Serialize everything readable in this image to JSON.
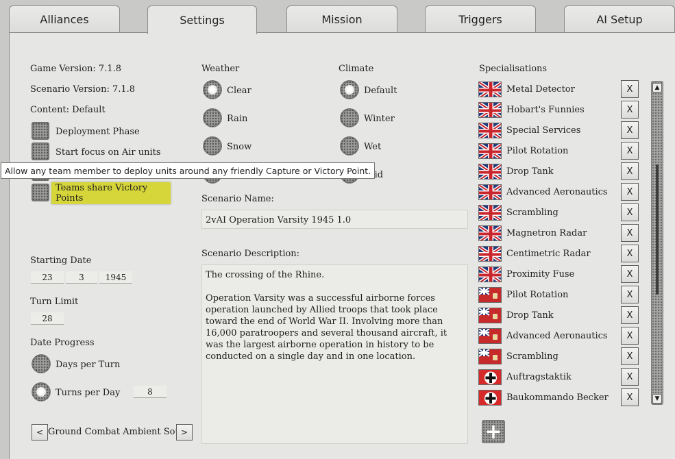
{
  "tabs": [
    {
      "label": "Alliances"
    },
    {
      "label": "Settings"
    },
    {
      "label": "Mission"
    },
    {
      "label": "Triggers"
    },
    {
      "label": "AI Setup"
    }
  ],
  "left": {
    "game_version": "Game Version: 7.1.8",
    "scenario_version": "Scenario Version: 7.1.8",
    "content": "Content: Default",
    "deployment_phase": "Deployment Phase",
    "start_focus": "Start focus on Air units",
    "teams_share_vp": "Teams share Victory Points",
    "starting_date_label": "Starting Date",
    "date_day": "23",
    "date_month": "3",
    "date_year": "1945",
    "turn_limit_label": "Turn Limit",
    "turn_limit": "28",
    "date_progress_label": "Date Progress",
    "days_per_turn": "Days per Turn",
    "turns_per_day": "Turns per Day",
    "turns_per_day_value": "8",
    "ambient_sound": "Ground Combat Ambient Sound",
    "prev_label": "<",
    "next_label": ">"
  },
  "tooltip": "Allow any team member to deploy units around any friendly Capture or Victory Point.",
  "weather": {
    "label": "Weather",
    "options": [
      "Clear",
      "Rain",
      "Snow"
    ]
  },
  "climate": {
    "label": "Climate",
    "options": [
      "Default",
      "Winter",
      "Wet",
      "Arid"
    ]
  },
  "scenario": {
    "name_label": "Scenario Name:",
    "name": "2vAI Operation Varsity 1945 1.0",
    "desc_label": "Scenario Description:",
    "desc_line1": "The crossing of the Rhine.",
    "desc_para": "Operation Varsity was a successful airborne forces operation launched by Allied troops that took place toward the end of World War II. Involving more than 16,000 paratroopers and several thousand aircraft, it was the largest airborne operation in history to be conducted on a single day and in one location."
  },
  "specialisations": {
    "label": "Specialisations",
    "remove_label": "X",
    "add_label": "+",
    "items": [
      {
        "name": "Metal Detector",
        "flag": "uk-flag-icon"
      },
      {
        "name": "Hobart's Funnies",
        "flag": "uk-flag-icon"
      },
      {
        "name": "Special Services",
        "flag": "uk-flag-icon"
      },
      {
        "name": "Pilot Rotation",
        "flag": "uk-flag-icon"
      },
      {
        "name": "Drop Tank",
        "flag": "uk-flag-icon"
      },
      {
        "name": "Advanced Aeronautics",
        "flag": "uk-flag-icon"
      },
      {
        "name": "Scrambling",
        "flag": "uk-flag-icon"
      },
      {
        "name": "Magnetron Radar",
        "flag": "uk-flag-icon"
      },
      {
        "name": "Centimetric Radar",
        "flag": "uk-flag-icon"
      },
      {
        "name": "Proximity Fuse",
        "flag": "uk-flag-icon"
      },
      {
        "name": "Pilot Rotation",
        "flag": "canada-red-ensign-icon"
      },
      {
        "name": "Drop Tank",
        "flag": "canada-red-ensign-icon"
      },
      {
        "name": "Advanced Aeronautics",
        "flag": "canada-red-ensign-icon"
      },
      {
        "name": "Scrambling",
        "flag": "canada-red-ensign-icon"
      },
      {
        "name": "Auftragstaktik",
        "flag": "german-cross-icon"
      },
      {
        "name": "Baukommando Becker",
        "flag": "german-cross-icon"
      }
    ]
  },
  "scroll": {
    "up": "▲",
    "down": "▼"
  }
}
